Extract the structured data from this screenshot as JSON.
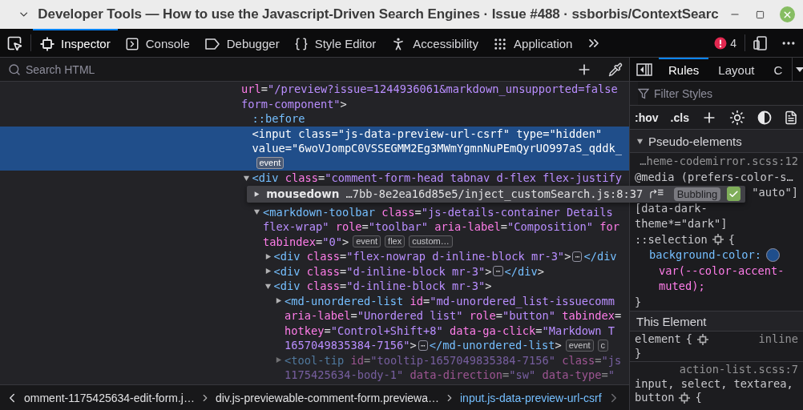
{
  "window": {
    "title": "Developer Tools — How to use the Javascript-Driven Search Engines · Issue #488 · ssborbis/ContextSearc"
  },
  "toolbar": {
    "tabs": [
      {
        "label": "Inspector",
        "selected": true
      },
      {
        "label": "Console",
        "selected": false
      },
      {
        "label": "Debugger",
        "selected": false
      },
      {
        "label": "Style Editor",
        "selected": false
      },
      {
        "label": "Accessibility",
        "selected": false
      },
      {
        "label": "Application",
        "selected": false
      }
    ],
    "error_count": "4"
  },
  "inspector": {
    "search": {
      "placeholder": "Search HTML"
    },
    "markup": [
      {
        "selected": false,
        "lines": [
          [
            {
              "kind": "attr",
              "text": "url"
            },
            {
              "kind": "punct",
              "text": "="
            },
            {
              "kind": "value",
              "text": "\"/preview?issue=1244936061&markdown_unsupported=false"
            }
          ],
          [
            {
              "kind": "value",
              "text": "form-component\""
            },
            {
              "kind": "punct",
              "text": ">"
            }
          ]
        ],
        "children": [
          {
            "selected": false,
            "lines": [
              [
                {
                  "kind": "pseudo",
                  "text": "::before"
                }
              ]
            ]
          },
          {
            "selected": true,
            "lines": [
              [
                {
                  "kind": "tag",
                  "text": "<input"
                },
                {
                  "kind": "attr",
                  "text": " class"
                },
                {
                  "kind": "punct",
                  "text": "="
                },
                {
                  "kind": "value",
                  "text": "\"js-data-preview-url-csrf\""
                },
                {
                  "kind": "attr",
                  "text": " type"
                },
                {
                  "kind": "punct",
                  "text": "="
                },
                {
                  "kind": "value",
                  "text": "\"hidden\""
                }
              ],
              [
                {
                  "kind": "attr",
                  "text": "value"
                },
                {
                  "kind": "punct",
                  "text": "="
                },
                {
                  "kind": "value",
                  "text": "\"6woVJompC0VSSEGMM2Eg3MWmYgmnNuPEmQyrUO997aS_qddk_"
                }
              ],
              [
                {
                  "kind": "badge",
                  "text": "event"
                }
              ]
            ]
          },
          {
            "selected": false,
            "expanded": true,
            "lines": [
              [
                {
                  "kind": "tag",
                  "text": "<div"
                },
                {
                  "kind": "attr",
                  "text": " class"
                },
                {
                  "kind": "punct",
                  "text": "="
                },
                {
                  "kind": "value",
                  "text": "\"comment-form-head tabnav d-flex flex-justify"
                }
              ]
            ],
            "popup": {
              "expanded": false,
              "event": "mousedown",
              "source": "…7bb-8e2ea16d85e5/inject_customSearch.js:8:37",
              "phase": "Bubbling",
              "checked": true
            },
            "children": [
              {
                "selected": false,
                "expanded": true,
                "lines": [
                  [
                    {
                      "kind": "tag",
                      "text": "<markdown-toolbar"
                    },
                    {
                      "kind": "attr",
                      "text": " class"
                    },
                    {
                      "kind": "punct",
                      "text": "="
                    },
                    {
                      "kind": "value",
                      "text": "\"js-details-container Details"
                    }
                  ],
                  [
                    {
                      "kind": "value",
                      "text": "flex-wrap\""
                    },
                    {
                      "kind": "attr",
                      "text": " role"
                    },
                    {
                      "kind": "punct",
                      "text": "="
                    },
                    {
                      "kind": "value",
                      "text": "\"toolbar\""
                    },
                    {
                      "kind": "attr",
                      "text": " aria-label"
                    },
                    {
                      "kind": "punct",
                      "text": "="
                    },
                    {
                      "kind": "value",
                      "text": "\"Composition\""
                    },
                    {
                      "kind": "attr",
                      "text": " for"
                    }
                  ],
                  [
                    {
                      "kind": "attr",
                      "text": "tabindex"
                    },
                    {
                      "kind": "punct",
                      "text": "="
                    },
                    {
                      "kind": "value",
                      "text": "\"0\""
                    },
                    {
                      "kind": "punct",
                      "text": ">"
                    },
                    {
                      "kind": "badge",
                      "text": "event"
                    },
                    {
                      "kind": "badge",
                      "text": "flex"
                    },
                    {
                      "kind": "badge",
                      "text": "custom…"
                    }
                  ]
                ],
                "children": [
                  {
                    "selected": false,
                    "expanded": false,
                    "lines": [
                      [
                        {
                          "kind": "tag",
                          "text": "<div"
                        },
                        {
                          "kind": "attr",
                          "text": " class"
                        },
                        {
                          "kind": "punct",
                          "text": "="
                        },
                        {
                          "kind": "value",
                          "text": "\"flex-nowrap d-inline-block mr-3\""
                        },
                        {
                          "kind": "punct",
                          "text": ">"
                        },
                        {
                          "kind": "ellipsis",
                          "text": "⋯"
                        },
                        {
                          "kind": "tag",
                          "text": "</div"
                        }
                      ]
                    ]
                  },
                  {
                    "selected": false,
                    "expanded": false,
                    "lines": [
                      [
                        {
                          "kind": "tag",
                          "text": "<div"
                        },
                        {
                          "kind": "attr",
                          "text": " class"
                        },
                        {
                          "kind": "punct",
                          "text": "="
                        },
                        {
                          "kind": "value",
                          "text": "\"d-inline-block mr-3\""
                        },
                        {
                          "kind": "punct",
                          "text": ">"
                        },
                        {
                          "kind": "ellipsis",
                          "text": "⋯"
                        },
                        {
                          "kind": "tag",
                          "text": "</div"
                        },
                        {
                          "kind": "punct",
                          "text": ">"
                        }
                      ]
                    ]
                  },
                  {
                    "selected": false,
                    "expanded": true,
                    "lines": [
                      [
                        {
                          "kind": "tag",
                          "text": "<div"
                        },
                        {
                          "kind": "attr",
                          "text": " class"
                        },
                        {
                          "kind": "punct",
                          "text": "="
                        },
                        {
                          "kind": "value",
                          "text": "\"d-inline-block mr-3\""
                        },
                        {
                          "kind": "punct",
                          "text": ">"
                        }
                      ]
                    ],
                    "children": [
                      {
                        "selected": false,
                        "expanded": false,
                        "lines": [
                          [
                            {
                              "kind": "tag",
                              "text": "<md-unordered-list"
                            },
                            {
                              "kind": "attr",
                              "text": " id"
                            },
                            {
                              "kind": "punct",
                              "text": "="
                            },
                            {
                              "kind": "value",
                              "text": "\"md-unordered_list-issuecomm"
                            }
                          ],
                          [
                            {
                              "kind": "attr",
                              "text": "aria-label"
                            },
                            {
                              "kind": "punct",
                              "text": "="
                            },
                            {
                              "kind": "value",
                              "text": "\"Unordered list\""
                            },
                            {
                              "kind": "attr",
                              "text": " role"
                            },
                            {
                              "kind": "punct",
                              "text": "="
                            },
                            {
                              "kind": "value",
                              "text": "\"button\""
                            },
                            {
                              "kind": "attr",
                              "text": " tabindex"
                            },
                            {
                              "kind": "punct",
                              "text": "="
                            }
                          ],
                          [
                            {
                              "kind": "attr",
                              "text": "hotkey"
                            },
                            {
                              "kind": "punct",
                              "text": "="
                            },
                            {
                              "kind": "value",
                              "text": "\"Control+Shift+8\""
                            },
                            {
                              "kind": "attr",
                              "text": " data-ga-click"
                            },
                            {
                              "kind": "punct",
                              "text": "="
                            },
                            {
                              "kind": "value",
                              "text": "\"Markdown T"
                            }
                          ],
                          [
                            {
                              "kind": "value",
                              "text": "1657049835384-7156\""
                            },
                            {
                              "kind": "punct",
                              "text": ">"
                            },
                            {
                              "kind": "ellipsis",
                              "text": "⋯"
                            },
                            {
                              "kind": "tag",
                              "text": "</md-unordered-list"
                            },
                            {
                              "kind": "punct",
                              "text": ">"
                            },
                            {
                              "kind": "badge",
                              "text": "event"
                            },
                            {
                              "kind": "badge",
                              "text": "c"
                            }
                          ]
                        ]
                      },
                      {
                        "selected": false,
                        "expanded": false,
                        "dim": true,
                        "lines": [
                          [
                            {
                              "kind": "tag",
                              "text": "<tool-tip"
                            },
                            {
                              "kind": "attr",
                              "text": " id"
                            },
                            {
                              "kind": "punct",
                              "text": "="
                            },
                            {
                              "kind": "value",
                              "text": "\"tooltip-1657049835384-7156\""
                            },
                            {
                              "kind": "attr",
                              "text": " class"
                            },
                            {
                              "kind": "punct",
                              "text": "="
                            },
                            {
                              "kind": "value",
                              "text": "\"js"
                            }
                          ],
                          [
                            {
                              "kind": "value",
                              "text": "1175425634-body-1\""
                            },
                            {
                              "kind": "attr",
                              "text": " data-direction"
                            },
                            {
                              "kind": "punct",
                              "text": "="
                            },
                            {
                              "kind": "value",
                              "text": "\"sw\""
                            },
                            {
                              "kind": "attr",
                              "text": " data-type"
                            },
                            {
                              "kind": "punct",
                              "text": "="
                            },
                            {
                              "kind": "value",
                              "text": "\""
                            }
                          ]
                        ]
                      }
                    ]
                  }
                ]
              }
            ]
          }
        ]
      }
    ],
    "breadcrumbs": [
      {
        "label": "omment-1175425634-edit-form.j…",
        "selected": false
      },
      {
        "label": "div.js-previewable-comment-form.previewa…",
        "selected": false
      },
      {
        "label": "input.js-data-preview-url-csrf",
        "selected": true
      }
    ]
  },
  "sidebar": {
    "tabs": [
      {
        "label": "Rules",
        "selected": true
      },
      {
        "label": "Layout",
        "selected": false
      },
      {
        "label": "C",
        "selected": false
      }
    ],
    "filter": {
      "placeholder": "Filter Styles"
    },
    "toggles": [
      ":hov",
      ".cls"
    ],
    "pseudo_elements": {
      "title": "Pseudo-elements",
      "expanded": true,
      "source": "…heme-codemirror.scss:12",
      "selector_lines": [
        {
          "text": "@media (prefers-color-s…",
          "covered": false
        },
        {
          "text": "\"auto\"]",
          "covered": true
        },
        {
          "text": "[data-dark-",
          "covered": false
        },
        {
          "text": "theme*=\"dark\"]",
          "covered": false
        },
        {
          "text": "::selection",
          "covered": false
        }
      ],
      "open": "{",
      "declarations": [
        {
          "property": "background-color:",
          "color": "#1f4e8c",
          "value_lines": [
            "var(--color-accent-",
            "muted);"
          ]
        }
      ],
      "close": "}"
    },
    "this_element": {
      "title": "This Element",
      "selector": "element",
      "open": "{",
      "origin": "inline",
      "close": "}"
    },
    "next_rule": {
      "source": "action-list.scss:7",
      "selector_lines": [
        "input, select, textarea,",
        "button"
      ],
      "open": "{"
    }
  }
}
